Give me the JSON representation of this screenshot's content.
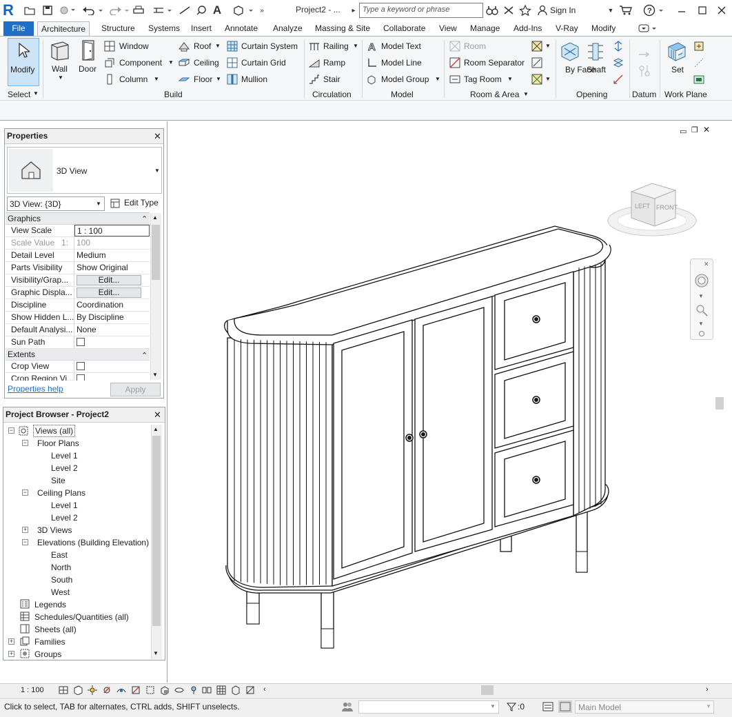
{
  "window": {
    "title": "Project2 - ...",
    "search_placeholder": "Type a keyword or phrase",
    "sign_in": "Sign In"
  },
  "tabs": [
    "File",
    "Architecture",
    "Structure",
    "Systems",
    "Insert",
    "Annotate",
    "Analyze",
    "Massing & Site",
    "Collaborate",
    "View",
    "Manage",
    "Add-Ins",
    "V-Ray",
    "Modify"
  ],
  "ribbon": {
    "select": {
      "modify": "Modify",
      "title": "Select"
    },
    "build": {
      "wall": "Wall",
      "door": "Door",
      "window": "Window",
      "component": "Component",
      "column": "Column",
      "roof": "Roof",
      "ceiling": "Ceiling",
      "floor": "Floor",
      "curtain_system": "Curtain System",
      "curtain_grid": "Curtain Grid",
      "mullion": "Mullion",
      "title": "Build"
    },
    "circulation": {
      "railing": "Railing",
      "ramp": "Ramp",
      "stair": "Stair",
      "title": "Circulation"
    },
    "model": {
      "model_text": "Model Text",
      "model_line": "Model Line",
      "model_group": "Model Group",
      "title": "Model"
    },
    "room_area": {
      "room": "Room",
      "room_separator": "Room Separator",
      "tag_room": "Tag Room",
      "title": "Room & Area"
    },
    "opening": {
      "by_face": "By Face",
      "shaft": "Shaft",
      "title": "Opening"
    },
    "datum": {
      "title": "Datum"
    },
    "work_plane": {
      "set": "Set",
      "title": "Work Plane"
    }
  },
  "properties": {
    "title": "Properties",
    "type_name": "3D View",
    "instance": "3D View: {3D}",
    "edit_type": "Edit Type",
    "groups": {
      "graphics": "Graphics",
      "extents": "Extents"
    },
    "rows": [
      {
        "name": "View Scale",
        "value": "1 : 100"
      },
      {
        "name": "Scale Value",
        "value": "100",
        "extra": "1:"
      },
      {
        "name": "Detail Level",
        "value": "Medium"
      },
      {
        "name": "Parts Visibility",
        "value": "Show Original"
      },
      {
        "name": "Visibility/Grap...",
        "value": "Edit..."
      },
      {
        "name": "Graphic Displa...",
        "value": "Edit..."
      },
      {
        "name": "Discipline",
        "value": "Coordination"
      },
      {
        "name": "Show Hidden L...",
        "value": "By Discipline"
      },
      {
        "name": "Default Analysi...",
        "value": "None"
      },
      {
        "name": "Sun Path",
        "value": ""
      }
    ],
    "extents_rows": [
      {
        "name": "Crop View",
        "value": ""
      },
      {
        "name": "Crop Region Vi...",
        "value": ""
      }
    ],
    "help": "Properties help",
    "apply": "Apply"
  },
  "browser": {
    "title": "Project Browser - Project2",
    "items": [
      "Views (all)",
      "Floor Plans",
      "Level 1",
      "Level 2",
      "Site",
      "Ceiling Plans",
      "Level 1",
      "Level 2",
      "3D Views",
      "Elevations (Building Elevation)",
      "East",
      "North",
      "South",
      "West",
      "Legends",
      "Schedules/Quantities (all)",
      "Sheets (all)",
      "Families",
      "Groups"
    ]
  },
  "viewcube": {
    "left": "LEFT",
    "front": "FRONT"
  },
  "viewbar": {
    "scale": "1 : 100"
  },
  "status": {
    "hint": "Click to select, TAB for alternates, CTRL adds, SHIFT unselects.",
    "count": ":0",
    "model": "Main Model"
  }
}
